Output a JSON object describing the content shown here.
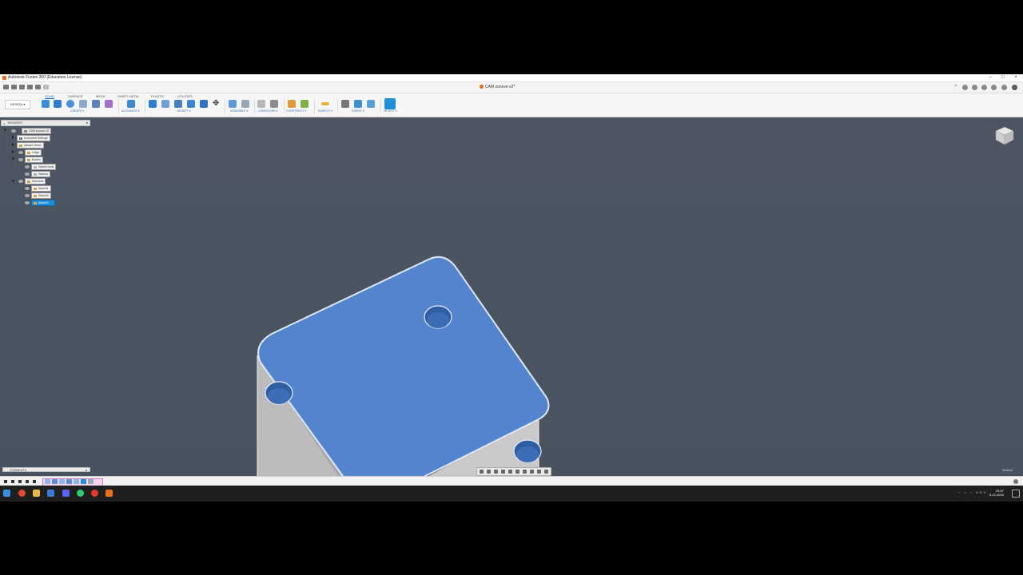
{
  "window": {
    "title": "Autodesk Fusion 360 (Education License)",
    "controls": [
      "–",
      "□",
      "×"
    ]
  },
  "document_tab": {
    "label": "CAM zonove v2*"
  },
  "ribbon": {
    "design_button": "DESIGN ▾",
    "workspace_tabs": [
      "SOLID",
      "SURFACE",
      "MESH",
      "SHEET METAL",
      "PLASTIC",
      "UTILITIES"
    ],
    "active_tab": "SOLID",
    "groups": [
      {
        "label": "CREATE ▾"
      },
      {
        "label": "AUTOMATE ▾"
      },
      {
        "label": "MODIFY ▾"
      },
      {
        "label": "ASSEMBLE ▾"
      },
      {
        "label": "CONFIGURE ▾"
      },
      {
        "label": "CONSTRUCT ▾"
      },
      {
        "label": "INSPECT ▾"
      },
      {
        "label": "INSERT ▾"
      },
      {
        "label": "SELECT ▾"
      }
    ]
  },
  "browser": {
    "header": "BROWSER",
    "root": "CAM zonove v2",
    "items": [
      {
        "label": "Document Settings"
      },
      {
        "label": "Named Views"
      },
      {
        "label": "Origin"
      },
      {
        "label": "Bodies"
      },
      {
        "label": "Sketch body"
      },
      {
        "label": "Stanica"
      },
      {
        "label": "Sketches"
      },
      {
        "label": "Sketch1"
      },
      {
        "label": "Sketch2"
      },
      {
        "label": "Sketch3"
      }
    ]
  },
  "comments": {
    "label": "COMMENTS"
  },
  "status": {
    "right_text": "Sketch3"
  },
  "taskbar": {
    "tray": "^ ⌂ ◔ HRV",
    "time": "23:57",
    "date": "6.12.2025"
  },
  "colors": {
    "viewport_bg": "#4b5461",
    "selected_face": "#4f7fc6",
    "selection_blue": "#1f8fd9",
    "body_gray": "#bdbdbd"
  }
}
